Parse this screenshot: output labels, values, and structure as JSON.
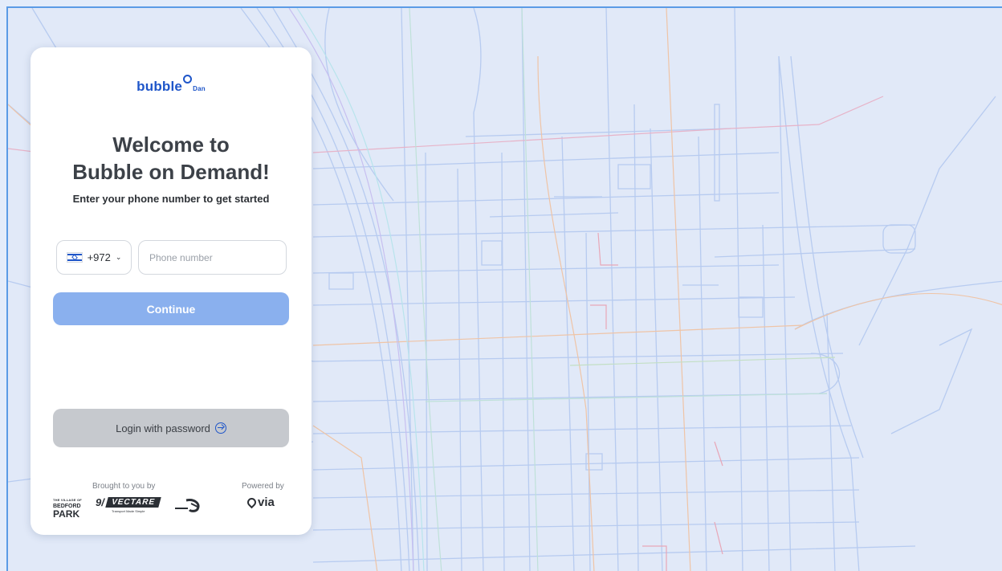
{
  "logo": {
    "word": "bubble",
    "sub": "Dan"
  },
  "welcome": {
    "line1": "Welcome to",
    "line2": "Bubble on Demand!",
    "subtitle": "Enter your phone number to get started"
  },
  "phone": {
    "country_code": "+972",
    "placeholder": "Phone number",
    "value": ""
  },
  "buttons": {
    "continue": "Continue",
    "login_password": "Login with password"
  },
  "footer": {
    "brought_by": "Brought to you by",
    "powered_by": "Powered by",
    "bedford": {
      "small": "THE VILLAGE OF",
      "mid": "BEDFORD",
      "big": "PARK"
    },
    "vectare": {
      "badge": "VECTARE",
      "tagline": "Transport Made Simple"
    },
    "via": "via"
  },
  "colors": {
    "accent": "#1f56c9",
    "continue_bg": "#8ab0ee",
    "login_bg": "#c6c9ce",
    "map_bg": "#e1e9f8"
  },
  "icons": [
    "israel-flag-icon",
    "chevron-down-icon",
    "login-arrow-icon",
    "metra-logo-icon",
    "via-pin-icon"
  ]
}
